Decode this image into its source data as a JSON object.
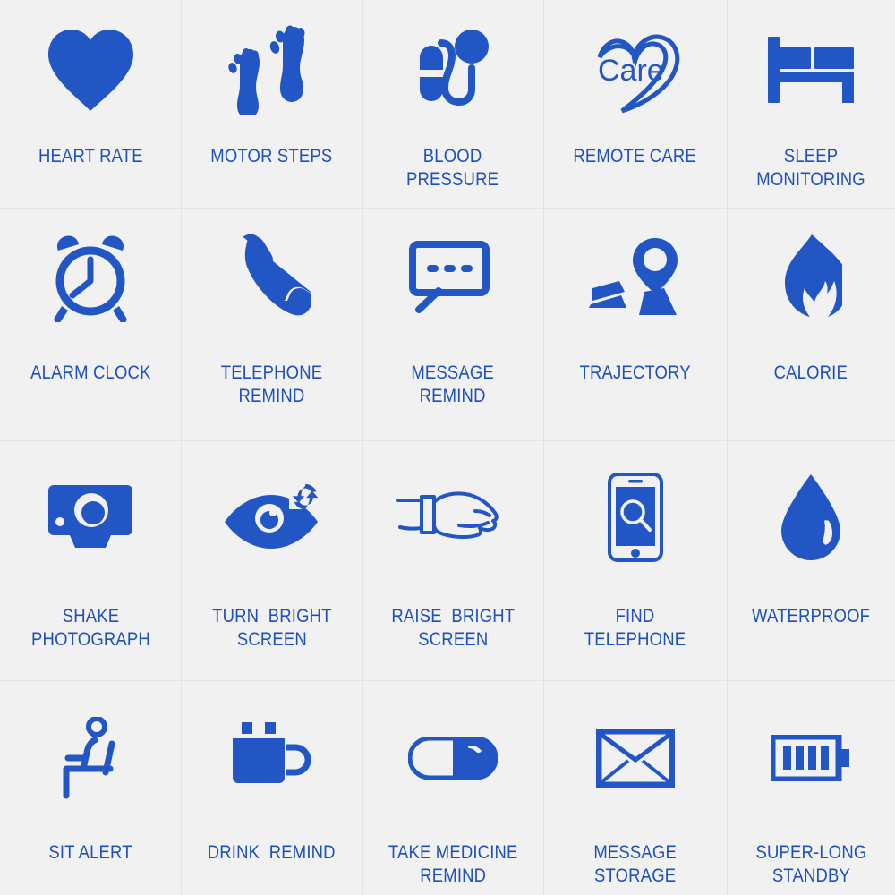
{
  "palette": {
    "brand_blue": "#1d50bf",
    "icon_blue": "#2256c4",
    "background": "#f1f1f1",
    "separator": "#e2e2e2"
  },
  "grid": {
    "columns": 5,
    "rows": 4
  },
  "features": [
    {
      "icon": "heart-icon",
      "label": "HEART RATE"
    },
    {
      "icon": "footprints-icon",
      "label": "MOTOR STEPS"
    },
    {
      "icon": "blood-pressure-cuff-icon",
      "label": "BLOOD\nPRESSURE"
    },
    {
      "icon": "care-heart-icon",
      "label": "REMOTE CARE",
      "icon_text": "Care"
    },
    {
      "icon": "bed-icon",
      "label": "SLEEP\nMONITORING"
    },
    {
      "icon": "alarm-clock-icon",
      "label": "ALARM CLOCK"
    },
    {
      "icon": "telephone-handset-icon",
      "label": "TELEPHONE\nREMIND"
    },
    {
      "icon": "speech-bubble-icon",
      "label": "MESSAGE\nREMIND"
    },
    {
      "icon": "map-pin-route-icon",
      "label": "TRAJECTORY"
    },
    {
      "icon": "flame-icon",
      "label": "CALORIE"
    },
    {
      "icon": "camera-icon",
      "label": "SHAKE\nPHOTOGRAPH"
    },
    {
      "icon": "eye-refresh-icon",
      "label": "TURN  BRIGHT\nSCREEN"
    },
    {
      "icon": "wrist-watch-icon",
      "label": "RAISE  BRIGHT\nSCREEN"
    },
    {
      "icon": "phone-search-icon",
      "label": "FIND\nTELEPHONE"
    },
    {
      "icon": "water-drop-icon",
      "label": "WATERPROOF"
    },
    {
      "icon": "sitting-person-icon",
      "label": "SIT ALERT"
    },
    {
      "icon": "coffee-mug-icon",
      "label": "DRINK  REMIND"
    },
    {
      "icon": "capsule-pill-icon",
      "label": "TAKE MEDICINE\nREMIND"
    },
    {
      "icon": "envelope-icon",
      "label": "MESSAGE\nSTORAGE"
    },
    {
      "icon": "battery-icon",
      "label": "SUPER-LONG\nSTANDBY"
    }
  ]
}
